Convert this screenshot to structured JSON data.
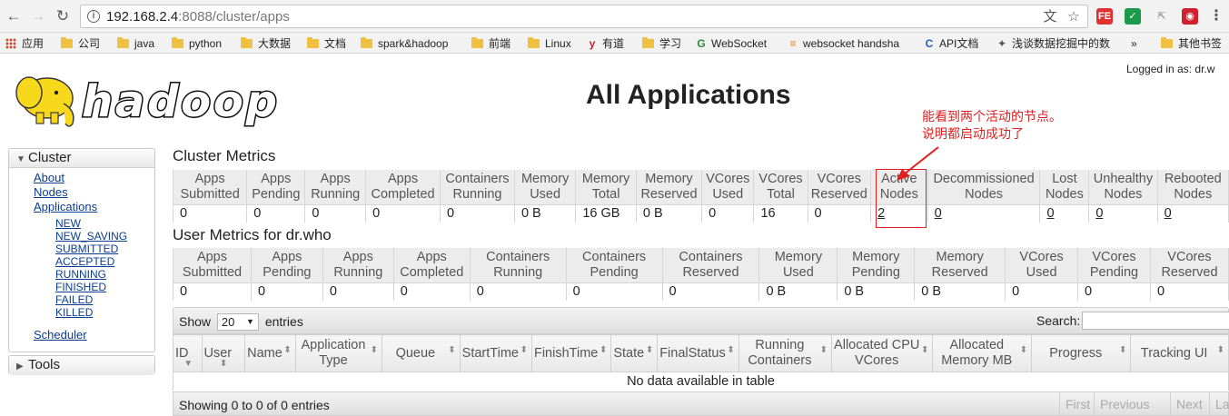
{
  "browser": {
    "url_host": "192.168.2.4",
    "url_rest": ":8088/cluster/apps",
    "bookmarks": [
      {
        "label": "应用",
        "icon": "apps-grid-icon"
      },
      {
        "label": "公司",
        "icon": "folder-icon"
      },
      {
        "label": "java",
        "icon": "folder-icon"
      },
      {
        "label": "python",
        "icon": "folder-icon"
      },
      {
        "label": "大数据",
        "icon": "folder-icon"
      },
      {
        "label": "文档",
        "icon": "folder-icon"
      },
      {
        "label": "spark&hadoop",
        "icon": "folder-icon"
      },
      {
        "label": "前端",
        "icon": "folder-icon"
      },
      {
        "label": "Linux",
        "icon": "folder-icon"
      },
      {
        "label": "有道",
        "icon": "youdao-icon"
      },
      {
        "label": "学习",
        "icon": "folder-icon"
      },
      {
        "label": "WebSocket",
        "icon": "google-icon"
      },
      {
        "label": "websocket handsha",
        "icon": "stack-icon"
      },
      {
        "label": "API文档",
        "icon": "api-icon"
      },
      {
        "label": "浅谈数据挖掘中的数",
        "icon": "page-icon"
      },
      {
        "label": "»",
        "icon": ""
      },
      {
        "label": "其他书签",
        "icon": "folder-icon"
      }
    ]
  },
  "header": {
    "logged_in": "Logged in as: dr.w",
    "title": "All Applications",
    "annotation_line1": "能看到两个活动的节点。",
    "annotation_line2": "说明都启动成功了"
  },
  "sidebar": {
    "cluster_label": "Cluster",
    "links": [
      "About",
      "Nodes",
      "Applications"
    ],
    "app_states": [
      "NEW",
      "NEW_SAVING",
      "SUBMITTED",
      "ACCEPTED",
      "RUNNING",
      "FINISHED",
      "FAILED",
      "KILLED"
    ],
    "scheduler": "Scheduler",
    "tools_label": "Tools"
  },
  "cluster_metrics": {
    "title": "Cluster Metrics",
    "headers": [
      [
        "Apps",
        "Submitted"
      ],
      [
        "Apps",
        "Pending"
      ],
      [
        "Apps",
        "Running"
      ],
      [
        "Apps",
        "Completed"
      ],
      [
        "Containers",
        "Running"
      ],
      [
        "Memory",
        "Used"
      ],
      [
        "Memory",
        "Total"
      ],
      [
        "Memory",
        "Reserved"
      ],
      [
        "VCores",
        "Used"
      ],
      [
        "VCores",
        "Total"
      ],
      [
        "VCores",
        "Reserved"
      ],
      [
        "Active",
        "Nodes"
      ],
      [
        "Decommissioned",
        "Nodes"
      ],
      [
        "Lost",
        "Nodes"
      ],
      [
        "Unhealthy",
        "Nodes"
      ],
      [
        "Rebooted",
        "Nodes"
      ]
    ],
    "values": [
      "0",
      "0",
      "0",
      "0",
      "0",
      "0 B",
      "16 GB",
      "0 B",
      "0",
      "16",
      "0",
      "2",
      "0",
      "0",
      "0",
      "0"
    ]
  },
  "user_metrics": {
    "title": "User Metrics for dr.who",
    "headers": [
      [
        "Apps",
        "Submitted"
      ],
      [
        "Apps",
        "Pending"
      ],
      [
        "Apps",
        "Running"
      ],
      [
        "Apps",
        "Completed"
      ],
      [
        "Containers",
        "Running"
      ],
      [
        "Containers",
        "Pending"
      ],
      [
        "Containers",
        "Reserved"
      ],
      [
        "Memory",
        "Used"
      ],
      [
        "Memory",
        "Pending"
      ],
      [
        "Memory",
        "Reserved"
      ],
      [
        "VCores",
        "Used"
      ],
      [
        "VCores",
        "Pending"
      ],
      [
        "VCores",
        "Reserved"
      ]
    ],
    "values": [
      "0",
      "0",
      "0",
      "0",
      "0",
      "0",
      "0",
      "0 B",
      "0 B",
      "0 B",
      "0",
      "0",
      "0"
    ]
  },
  "apps_table": {
    "show_label": "Show",
    "entries_value": "20",
    "entries_label": "entries",
    "search_label": "Search:",
    "columns": [
      [
        "ID",
        ""
      ],
      [
        "User",
        ""
      ],
      [
        "Name",
        ""
      ],
      [
        "Application",
        "Type"
      ],
      [
        "Queue",
        ""
      ],
      [
        "StartTime",
        ""
      ],
      [
        "FinishTime",
        ""
      ],
      [
        "State",
        ""
      ],
      [
        "FinalStatus",
        ""
      ],
      [
        "Running",
        "Containers"
      ],
      [
        "Allocated CPU",
        "VCores"
      ],
      [
        "Allocated",
        "Memory MB"
      ],
      [
        "Progress",
        ""
      ],
      [
        "Tracking UI",
        ""
      ]
    ],
    "empty_message": "No data available in table",
    "info": "Showing 0 to 0 of 0 entries",
    "pager": [
      "First",
      "Previous",
      "Next",
      "Last"
    ]
  }
}
